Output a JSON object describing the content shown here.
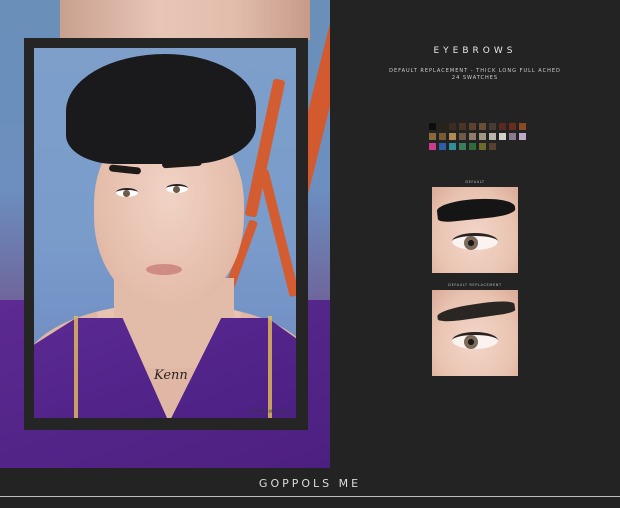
{
  "header": {
    "title": "EYEBROWS",
    "subtitle_line1": "DEFAULT REPLACEMENT - THICK LONG FULL ACHED",
    "subtitle_line2": "24 SWATCHES"
  },
  "swatches": [
    "#0d0d0d",
    "#2b2217",
    "#3e2c1e",
    "#4a3524",
    "#5e432c",
    "#6a4f35",
    "#4a3a36",
    "#5a2a22",
    "#6b2b1d",
    "#8a4a22",
    "#8a6a3a",
    "#7a5a2e",
    "#b08a52",
    "#6f5a47",
    "#8f7d6b",
    "#a49684",
    "#b8b4ac",
    "#d3d0cb",
    "#8a7a90",
    "#c0a8c8",
    "#c93d8a",
    "#2c5fa8",
    "#2f8f9a",
    "#3b7d5a",
    "#2f6b3b",
    "#6a6a2a",
    "#5a4030"
  ],
  "previews": [
    {
      "label": "DEFAULT"
    },
    {
      "label": "DEFAULT REPLACEMENT"
    }
  ],
  "artwork": {
    "tattoo": "Kenn",
    "credit": "GOPPOLSME 2022"
  },
  "footer": {
    "brand": "GOPPOLS ME"
  }
}
